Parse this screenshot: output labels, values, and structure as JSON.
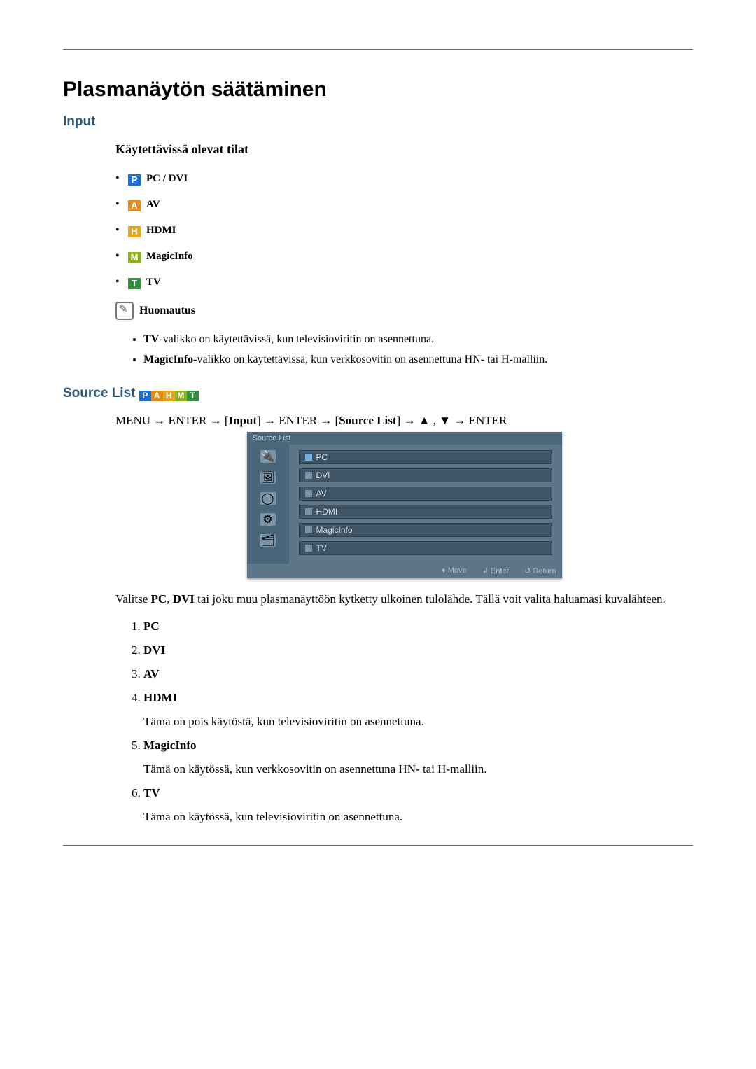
{
  "title": "Plasmanäytön säätäminen",
  "section_input": "Input",
  "modes_heading": "Käytettävissä olevat tilat",
  "modes": [
    {
      "letter": "P",
      "label": "PC / DVI"
    },
    {
      "letter": "A",
      "label": "AV"
    },
    {
      "letter": "H",
      "label": "HDMI"
    },
    {
      "letter": "M",
      "label": "MagicInfo"
    },
    {
      "letter": "T",
      "label": "TV"
    }
  ],
  "note_label": "Huomautus",
  "notes": [
    {
      "bold": "TV",
      "rest": "-valikko on käytettävissä, kun televisioviritin on asennettuna."
    },
    {
      "bold": "MagicInfo",
      "rest": "-valikko on käytettävissä, kun verkkosovitin on asennettuna HN- tai H-malliin."
    }
  ],
  "source_list_label": "Source List",
  "nav_sequence": {
    "p0": "MENU → ENTER → [",
    "b1": "Input",
    "p1": "] → ENTER → [",
    "b2": "Source List",
    "p2": "] → ▲ , ▼ → ENTER"
  },
  "osd": {
    "header": "Source List",
    "items": [
      "PC",
      "DVI",
      "AV",
      "HDMI",
      "MagicInfo",
      "TV"
    ],
    "selected_index": 0,
    "footer": {
      "move": "Move",
      "enter": "Enter",
      "ret": "Return"
    }
  },
  "source_desc": {
    "pre": "Valitse ",
    "b1": "PC",
    "mid": ", ",
    "b2": "DVI",
    "post": " tai joku muu plasmanäyttöön kytketty ulkoinen tulolähde. Tällä voit valita haluamasi kuvalähteen."
  },
  "source_enum": [
    {
      "label": "PC",
      "note": ""
    },
    {
      "label": "DVI",
      "note": ""
    },
    {
      "label": "AV",
      "note": ""
    },
    {
      "label": "HDMI",
      "note": "Tämä on pois käytöstä, kun televisioviritin on asennettuna."
    },
    {
      "label": "MagicInfo",
      "note": "Tämä on käytössä, kun verkkosovitin on asennettuna HN- tai H-malliin."
    },
    {
      "label": "TV",
      "note": "Tämä on käytössä, kun televisioviritin on asennettuna."
    }
  ]
}
